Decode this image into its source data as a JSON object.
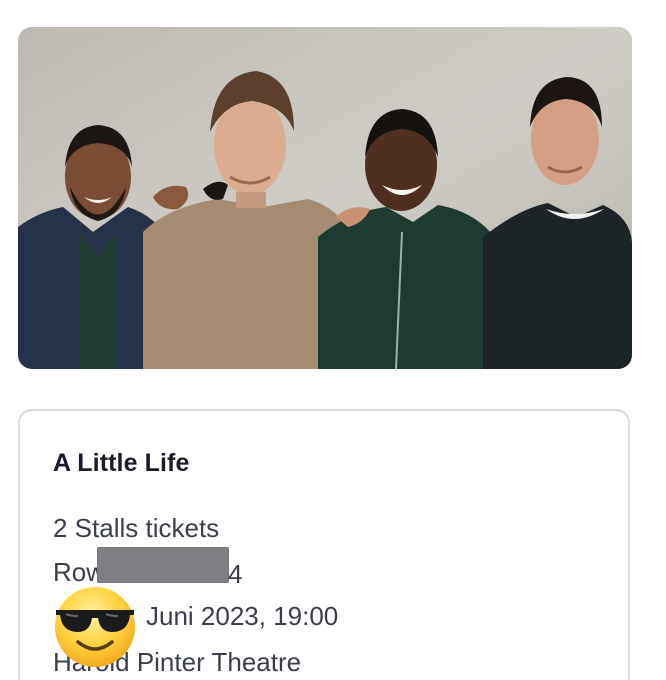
{
  "hero": {
    "icon": "cast-photo"
  },
  "ticket": {
    "title": "A Little Life",
    "tickets": "2 Stalls tickets",
    "row_prefix": "Row E",
    "row_suffix": "4",
    "date": "Juni 2023, 19:00",
    "venue": "Harold Pinter Theatre"
  },
  "overlay": {
    "emoji": "sunglasses-emoji"
  },
  "colors": {
    "card_border": "#d9dbe0",
    "title": "#1a1a2e",
    "body_text": "#3b3f4c",
    "redaction": "#7e7f82"
  }
}
